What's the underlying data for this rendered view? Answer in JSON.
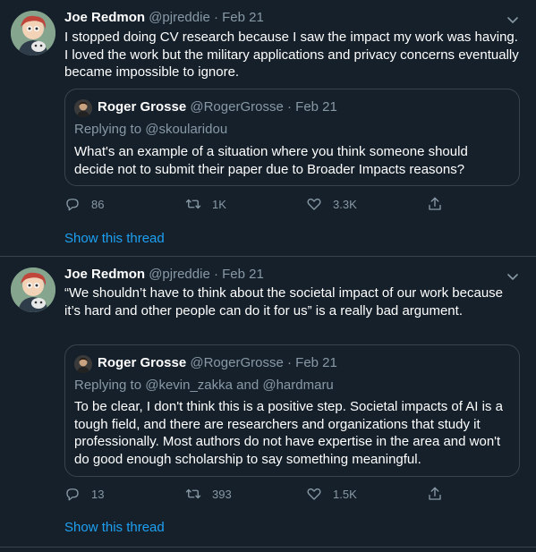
{
  "tweets": [
    {
      "author": "Joe Redmon",
      "handle": "@pjreddie",
      "separator": "·",
      "date": "Feb 21",
      "text": "I stopped doing CV research because I saw the impact my work was having. I loved the work but the military applications and privacy concerns eventually became impossible to ignore.",
      "quote": {
        "author": "Roger Grosse",
        "handle": "@RogerGrosse",
        "separator": "·",
        "date": "Feb 21",
        "replying_prefix": "Replying to",
        "replying_to": "@skoularidou",
        "text": "What's an example of a situation where you think someone should decide not to submit their paper due to Broader Impacts reasons?"
      },
      "replies": "86",
      "retweets": "1K",
      "likes": "3.3K",
      "show_thread": "Show this thread"
    },
    {
      "author": "Joe Redmon",
      "handle": "@pjreddie",
      "separator": "·",
      "date": "Feb 21",
      "text": "“We shouldn’t have to think about the societal impact of our work because it’s hard and other people can do it for us” is a really bad argument.",
      "quote": {
        "author": "Roger Grosse",
        "handle": "@RogerGrosse",
        "separator": "·",
        "date": "Feb 21",
        "replying_prefix": "Replying to",
        "replying_to": "@kevin_zakka and @hardmaru",
        "text": "To be clear, I don't think this is a positive step. Societal impacts of AI is a tough field, and there are researchers and organizations that study it professionally. Most authors do not have expertise in the area and won't do good enough scholarship to say something meaningful."
      },
      "replies": "13",
      "retweets": "393",
      "likes": "1.5K",
      "show_thread": "Show this thread"
    }
  ],
  "theme": {
    "background": "#15202b",
    "border": "#38444d",
    "secondary_text": "#8899a6",
    "link": "#1da1f2"
  },
  "icons": [
    "avatar",
    "chevron-down-icon",
    "reply-icon",
    "retweet-icon",
    "like-icon",
    "share-icon"
  ]
}
